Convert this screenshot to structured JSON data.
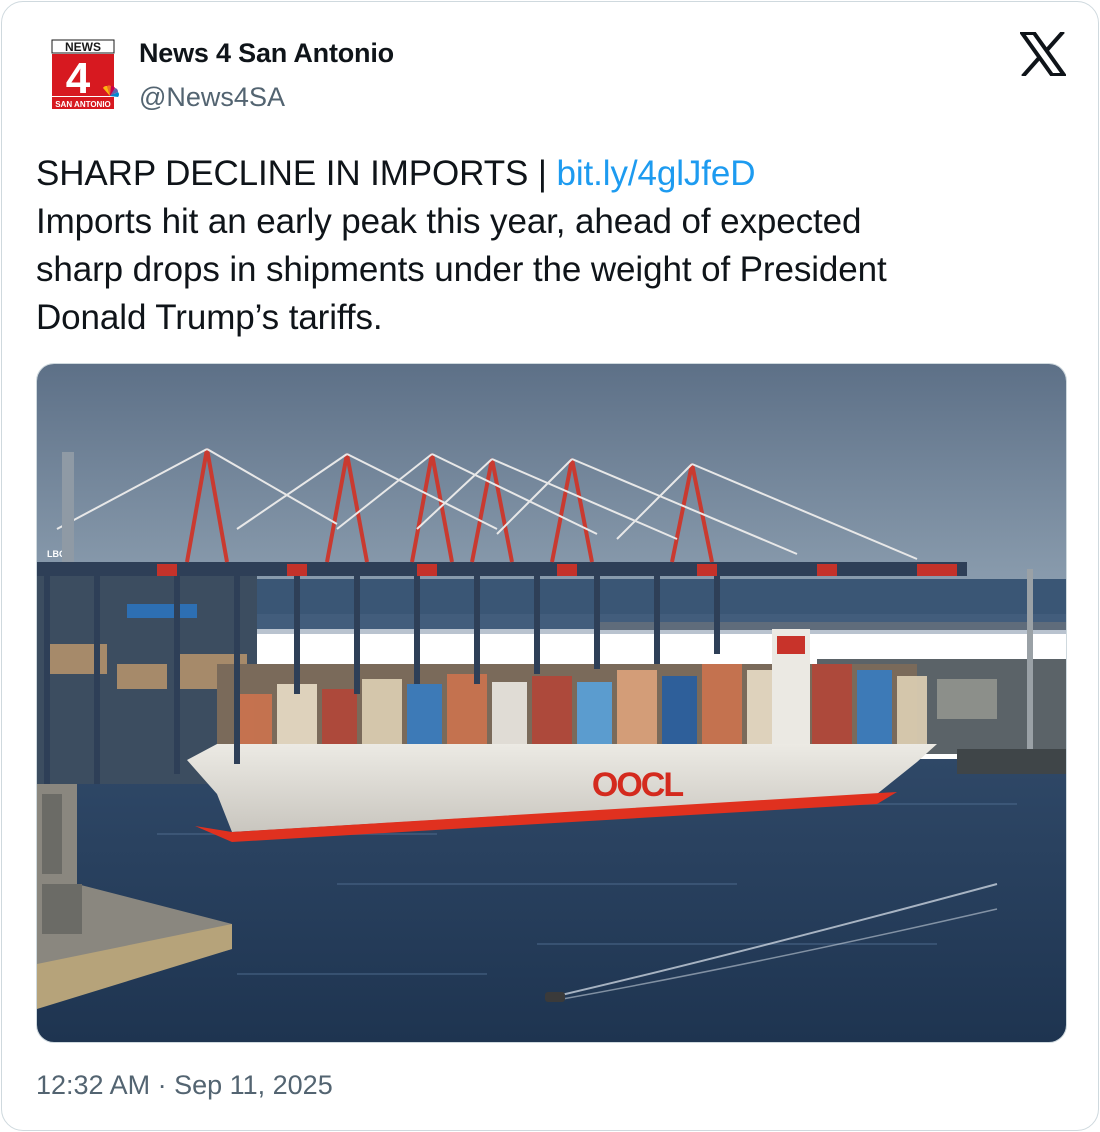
{
  "account": {
    "display_name": "News 4 San Antonio",
    "handle": "@News4SA",
    "avatar_icon": "news4-san-antonio-logo-icon",
    "avatar_text_top": "NEWS",
    "avatar_numeral": "4",
    "avatar_text_bottom": "SAN ANTONIO"
  },
  "platform": {
    "icon": "x-logo-icon"
  },
  "tweet": {
    "headline": "SHARP DECLINE IN IMPORTS | ",
    "link_text": "bit.ly/4glJfeD",
    "body_line_1": "Imports hit an early peak this year, ahead of expected",
    "body_line_2": "sharp drops in shipments under the weight of President",
    "body_line_3": "Donald Trump’s tariffs."
  },
  "media": {
    "ship_label": "OOCL",
    "crane_label": "LBCT"
  },
  "footer": {
    "timestamp": "12:32 AM · Sep 11, 2025"
  },
  "colors": {
    "link": "#1d9bf0",
    "secondary_text": "#536471",
    "border": "#cfd9de",
    "logo_red": "#d71920",
    "ship_red": "#e0311f"
  }
}
